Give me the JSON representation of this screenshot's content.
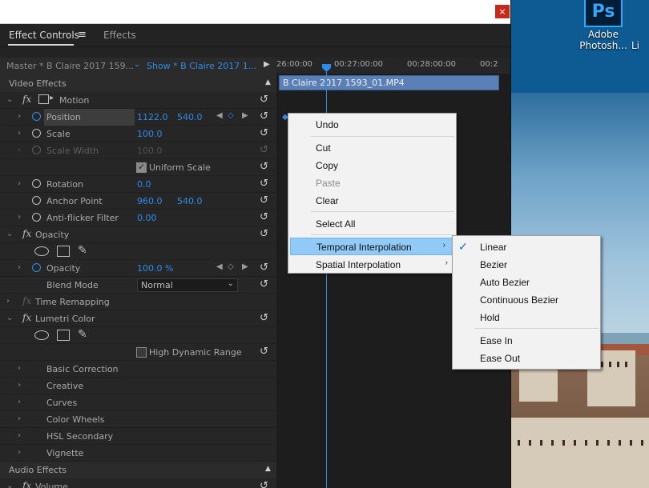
{
  "desktop": {
    "icons": [
      {
        "label_line1": "Adobe",
        "label_line2": "Photosh...",
        "tile": "Ps"
      },
      {
        "label_line1": "",
        "label_line2": "Li"
      }
    ]
  },
  "window": {
    "close_glyph": "×"
  },
  "tabs": {
    "effect_controls": "Effect Controls",
    "menu_glyph": "≡",
    "effects": "Effects"
  },
  "source": {
    "master": "Master * B Claire 2017 159...",
    "show": "Show * B Claire 2017 1..."
  },
  "video_effects_label": "Video Effects",
  "motion": {
    "label": "Motion",
    "position": {
      "label": "Position",
      "x": "1122.0",
      "y": "540.0"
    },
    "scale": {
      "label": "Scale",
      "value": "100.0"
    },
    "scale_width": {
      "label": "Scale Width",
      "value": "100.0"
    },
    "uniform_scale": {
      "label": "Uniform Scale",
      "checked": true
    },
    "rotation": {
      "label": "Rotation",
      "value": "0.0"
    },
    "anchor_point": {
      "label": "Anchor Point",
      "x": "960.0",
      "y": "540.0"
    },
    "anti_flicker": {
      "label": "Anti-flicker Filter",
      "value": "0.00"
    }
  },
  "opacity": {
    "label": "Opacity",
    "opacity_param": {
      "label": "Opacity",
      "value": "100.0 %"
    },
    "blend_mode": {
      "label": "Blend Mode",
      "value": "Normal"
    }
  },
  "time_remapping": {
    "label": "Time Remapping"
  },
  "lumetri": {
    "label": "Lumetri Color",
    "hdr": {
      "label": "High Dynamic Range",
      "checked": false
    },
    "sections": [
      "Basic Correction",
      "Creative",
      "Curves",
      "Color Wheels",
      "HSL Secondary",
      "Vignette"
    ]
  },
  "audio_effects_label": "Audio Effects",
  "volume": {
    "label": "Volume"
  },
  "timeline": {
    "ticks": [
      "26:00:00",
      "00:27:00:00",
      "00:28:00:00",
      "00:2"
    ],
    "clip_name": "B Claire 2017 1593_01.MP4"
  },
  "context_menu": {
    "undo": "Undo",
    "cut": "Cut",
    "copy": "Copy",
    "paste": "Paste",
    "clear": "Clear",
    "select_all": "Select All",
    "temporal_interpolation": "Temporal Interpolation",
    "spatial_interpolation": "Spatial Interpolation"
  },
  "submenu": {
    "linear": "Linear",
    "bezier": "Bezier",
    "auto_bezier": "Auto Bezier",
    "continuous_bezier": "Continuous Bezier",
    "hold": "Hold",
    "ease_in": "Ease In",
    "ease_out": "Ease Out",
    "checked_item": "Linear"
  },
  "colors": {
    "accent_blue": "#2d8ceb",
    "menu_highlight": "#91c9f7",
    "clip": "#5b80b8"
  }
}
